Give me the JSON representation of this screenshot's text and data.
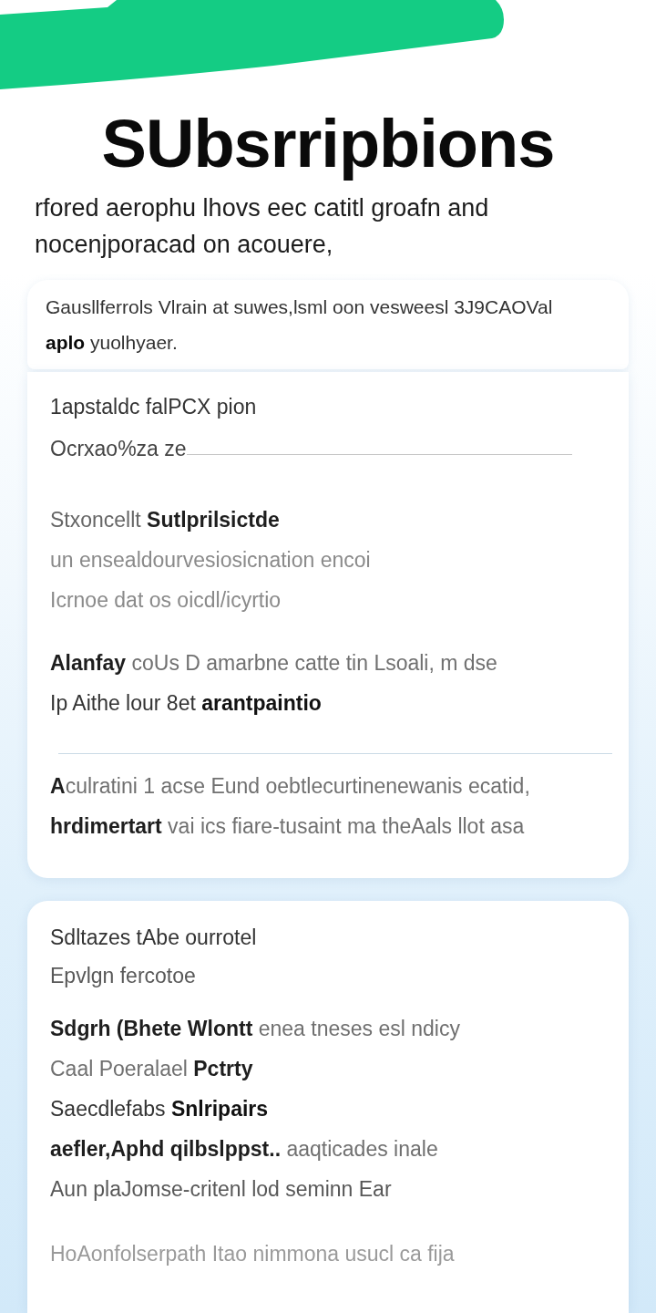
{
  "header": {
    "title": "SUbsrripbions",
    "subtitle": "rfored aerophu lhovs eec catitl groafn and\nnocenjporacad on acouere,"
  },
  "notice": {
    "text": "Gausllferrols Vlrain at suwes,lsml oon vesweesl 3J9CAOVal\n**aplo** yuolhyaer."
  },
  "cards": [
    {
      "items": [
        {
          "kind": "label",
          "text": "1apstaldc falPCX pion"
        },
        {
          "kind": "field",
          "value": "Ocrxao%za ze"
        },
        {
          "kind": "heading",
          "text": "Stxoncellt **Sutlprilsictde**"
        },
        {
          "kind": "muted",
          "text": "un ensealdourvesiosicnation encoi"
        },
        {
          "kind": "muted",
          "text": "Icrnoe dat os oicdl/icyrtio"
        },
        {
          "kind": "text",
          "text": "**Alanfay** coUs D amarbne catte tin Lsoali, m dse"
        },
        {
          "kind": "strong",
          "text": "Ip Aithe lour 8et **arantpaintio**"
        },
        {
          "kind": "divider"
        },
        {
          "kind": "text",
          "text": "**A**culratini 1 acse Eund oebtlecurtinenewanis ecatid,"
        },
        {
          "kind": "text",
          "text": "**hrdimertart** vai ics fiare-tusaint ma theAals llot asa"
        }
      ]
    },
    {
      "items": [
        {
          "kind": "title",
          "text": "Sdltazes tAbe ourrotel"
        },
        {
          "kind": "sub",
          "text": "Epvlgn fercotoe"
        },
        {
          "kind": "text",
          "text": "**Sdgrh (Bhete Wlontt** enea tneses esl ndicy"
        },
        {
          "kind": "text",
          "text": "Caal Poeralael **Pctrty**"
        },
        {
          "kind": "strong",
          "text": "Saecdlefabs **Snlripairs**"
        },
        {
          "kind": "text",
          "text": "**aefler,Aphd qilbslppst..** aaqticades inale"
        },
        {
          "kind": "sub",
          "text": "Aun plaJomse-critenl lod seminn Ear"
        },
        {
          "kind": "faint",
          "text": "HoAonfolserpath Itao nimmona usucl ca fija"
        }
      ]
    }
  ]
}
